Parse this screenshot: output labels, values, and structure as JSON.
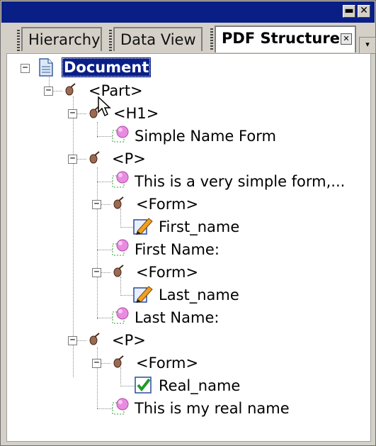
{
  "window": {
    "minimize_glyph": "▬",
    "close_glyph": "✕"
  },
  "tabs": [
    {
      "label": "Hierarchy",
      "active": false
    },
    {
      "label": "Data View",
      "active": false
    },
    {
      "label": "PDF Structure",
      "active": true
    }
  ],
  "tab_close_glyph": "✕",
  "tree": {
    "root": "Document",
    "part": "<Part>",
    "h1": "<H1>",
    "h1_text": "Simple Name Form",
    "p1": "<P>",
    "p1_text": "This is a very simple form,...",
    "form1": "<Form>",
    "form1_field": "First_name",
    "label1": "First Name:",
    "form2": "<Form>",
    "form2_field": "Last_name",
    "label2": "Last Name:",
    "p2": "<P>",
    "form3": "<Form>",
    "form3_field": "Real_name",
    "label3": "This is my real name",
    "collapse_glyph": "−"
  },
  "colors": {
    "title_bar": "#0a1f86",
    "selection": "#0a1f86",
    "tag_icon": "#9b6a52",
    "text_icon": "#e88ce0"
  },
  "icons": {
    "root": "document-icon",
    "tag": "tag-icon",
    "text": "text-content-icon",
    "field": "pencil-field-icon",
    "checkbox": "checkbox-field-icon"
  }
}
